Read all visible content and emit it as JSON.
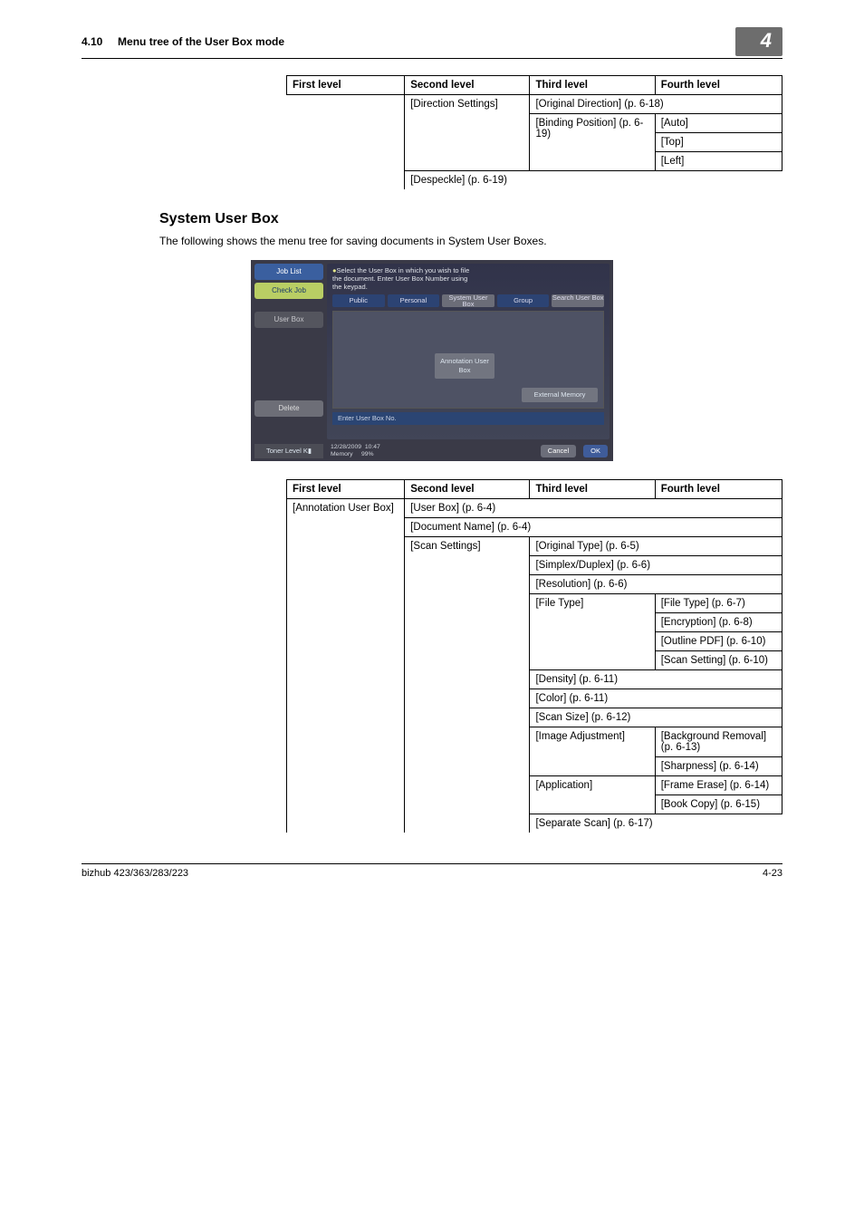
{
  "header": {
    "section_num": "4.10",
    "section_title": "Menu tree of the User Box mode",
    "chapter_badge": "4"
  },
  "table1": {
    "headers": {
      "c1": "First level",
      "c2": "Second level",
      "c3": "Third level",
      "c4": "Fourth level"
    },
    "r1": {
      "c2": "[Direction Settings]",
      "c3": "[Original Direction] (p. 6-18)"
    },
    "r2": {
      "c3": "[Binding Position] (p. 6-19)",
      "c4": "[Auto]"
    },
    "r3": {
      "c4": "[Top]"
    },
    "r4": {
      "c4": "[Left]"
    },
    "r5": {
      "c2": "[Despeckle] (p. 6-19)"
    }
  },
  "section2": {
    "title": "System User Box",
    "desc": "The following shows the menu tree for saving documents in System User Boxes."
  },
  "device": {
    "joblist": "Job List",
    "checkjob": "Check Job",
    "userbox_side": "User Box",
    "delete": "Delete",
    "msg_line1": "Select the User Box in which you wish to file",
    "msg_line2": "the document.  Enter User Box Number using",
    "msg_line3": "the keypad.",
    "tab_public": "Public",
    "tab_personal": "Personal",
    "tab_system": "System User Box",
    "tab_group": "Group",
    "tab_search": "Search User Box",
    "annotation": "Annotation User Box",
    "extmem": "External Memory",
    "enter": "Enter User Box No.",
    "toner": "Toner Level",
    "date": "12/28/2009",
    "time": "10:47",
    "mem": "Memory",
    "mempc": "99%",
    "cancel": "Cancel",
    "ok": "OK"
  },
  "table2": {
    "headers": {
      "c1": "First level",
      "c2": "Second level",
      "c3": "Third level",
      "c4": "Fourth level"
    },
    "r1": {
      "c1": "[Annotation User Box]",
      "c2": "[User Box] (p. 6-4)"
    },
    "r2": {
      "c2": "[Document Name] (p. 6-4)"
    },
    "r3": {
      "c2": "[Scan Settings]",
      "c3": "[Original Type] (p. 6-5)"
    },
    "r4": {
      "c3": "[Simplex/Duplex] (p. 6-6)"
    },
    "r5": {
      "c3": "[Resolution] (p. 6-6)"
    },
    "r6": {
      "c3": "[File Type]",
      "c4": "[File Type] (p. 6-7)"
    },
    "r7": {
      "c4": "[Encryption] (p. 6-8)"
    },
    "r8": {
      "c4": "[Outline PDF] (p. 6-10)"
    },
    "r9": {
      "c4": "[Scan Setting] (p. 6-10)"
    },
    "r10": {
      "c3": "[Density] (p. 6-11)"
    },
    "r11": {
      "c3": "[Color] (p. 6-11)"
    },
    "r12": {
      "c3": "[Scan Size] (p. 6-12)"
    },
    "r13": {
      "c3": "[Image Adjustment]",
      "c4": "[Background Removal] (p. 6-13)"
    },
    "r14": {
      "c4": "[Sharpness] (p. 6-14)"
    },
    "r15": {
      "c3": "[Application]",
      "c4": "[Frame Erase] (p. 6-14)"
    },
    "r16": {
      "c4": "[Book Copy] (p. 6-15)"
    },
    "r17": {
      "c3": "[Separate Scan] (p. 6-17)"
    }
  },
  "footer": {
    "model": "bizhub 423/363/283/223",
    "page": "4-23"
  }
}
